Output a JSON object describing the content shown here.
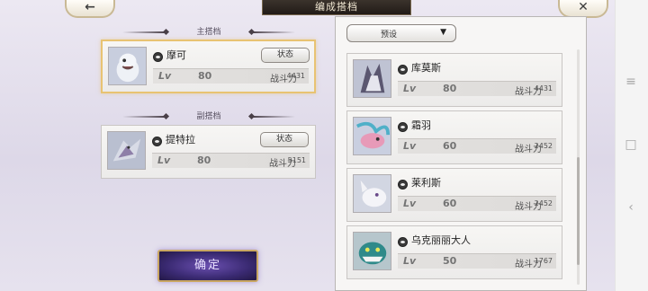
{
  "header": {
    "title": "编成搭档"
  },
  "sections": {
    "main_label": "主搭档",
    "sub_label": "副搭档"
  },
  "main_pet": {
    "name": "摩可",
    "lv_label": "Lv",
    "level": "80",
    "power_label": "战斗力",
    "power": "4431",
    "state_label": "状态"
  },
  "sub_pet": {
    "name": "提特拉",
    "lv_label": "Lv",
    "level": "80",
    "power_label": "战斗力",
    "power": "5151",
    "state_label": "状态"
  },
  "preset": {
    "label": "预设",
    "arrow": "▼"
  },
  "list": [
    {
      "name": "库莫斯",
      "lv_label": "Lv",
      "level": "80",
      "power_label": "战斗力",
      "power": "4431"
    },
    {
      "name": "霜羽",
      "lv_label": "Lv",
      "level": "60",
      "power_label": "战斗力",
      "power": "2452"
    },
    {
      "name": "莱利斯",
      "lv_label": "Lv",
      "level": "60",
      "power_label": "战斗力",
      "power": "2452"
    },
    {
      "name": "乌克丽丽大人",
      "lv_label": "Lv",
      "level": "50",
      "power_label": "战斗力",
      "power": "1767"
    }
  ],
  "buttons": {
    "confirm": "确定",
    "back_glyph": "🡐",
    "close_glyph": "✕"
  },
  "icons": {
    "back": "back-arrow-icon",
    "close": "close-icon",
    "element": "element-eye-icon"
  },
  "colors": {
    "accent_gold": "#e8c372",
    "confirm_purple": "#3a2a72"
  }
}
